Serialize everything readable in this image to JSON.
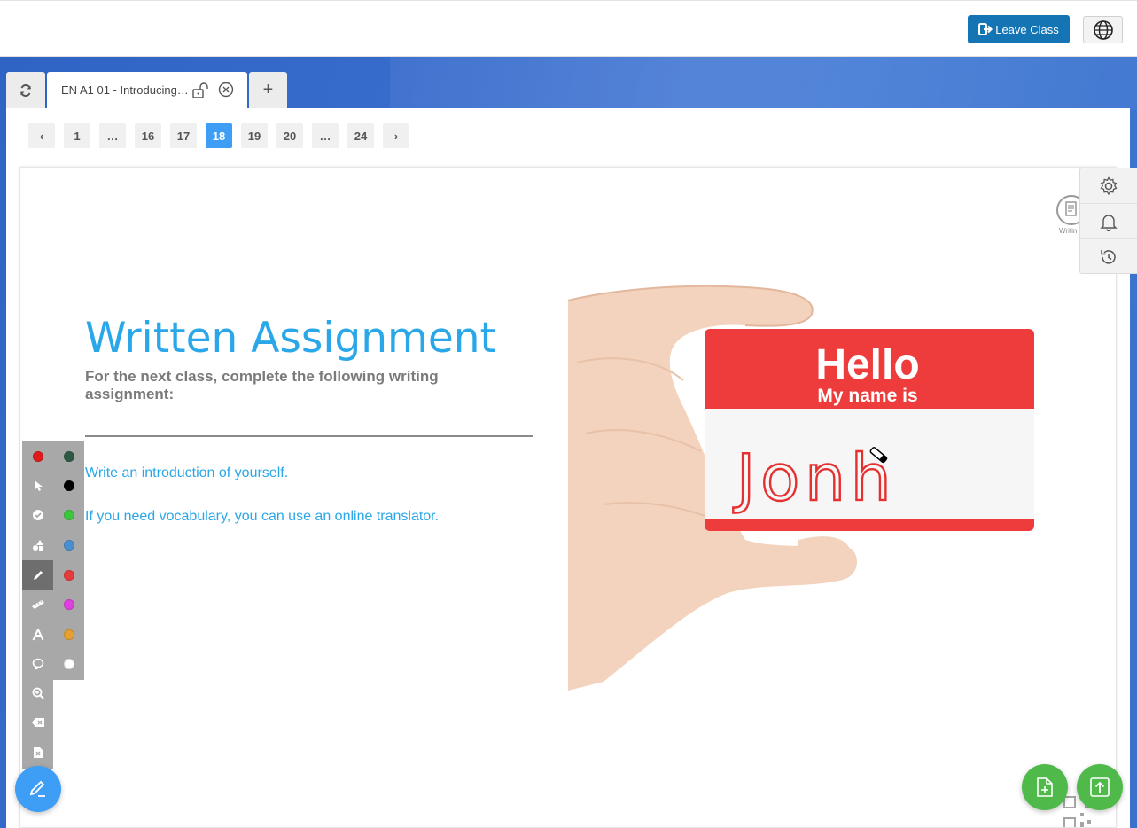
{
  "header": {
    "leave_label": "Leave Class",
    "leave_icon": "sign-out-icon",
    "language_icon": "globe-icon"
  },
  "tabs": {
    "refresh_icon": "refresh-icon",
    "active_title": "EN A1 01 - Introducing…",
    "add_label": "+"
  },
  "pagination": {
    "prev": "‹",
    "next": "›",
    "pages": [
      "1",
      "…",
      "16",
      "17",
      "18",
      "19",
      "20",
      "…",
      "24"
    ],
    "current": "18"
  },
  "slide": {
    "title": "Written Assignment",
    "subtitle": "For the next class, complete the following writing assignment:",
    "line1": "Write an introduction of yourself.",
    "line2": "If you need vocabulary, you can use an online translator.",
    "badge_hello": "Hello",
    "badge_name_is": "My name is",
    "handwritten_name": "Jonh",
    "corner_label": "Writin"
  },
  "draw_tools": [
    "red-color-dot",
    "pointer-icon",
    "check-icon",
    "shapes-icon",
    "pencil-icon",
    "ruler-icon",
    "text-icon",
    "lasso-icon",
    "zoom-icon",
    "eraser-icon",
    "clear-page-icon"
  ],
  "colors": [
    "#e01b1b",
    "#2d5a45",
    "#000000",
    "#3cc63c",
    "#4a90d0",
    "#e63b3b",
    "#e040e0",
    "#e8a030",
    "#ffffff"
  ],
  "accent": "#3e9ef5",
  "brand": "#1474b4"
}
